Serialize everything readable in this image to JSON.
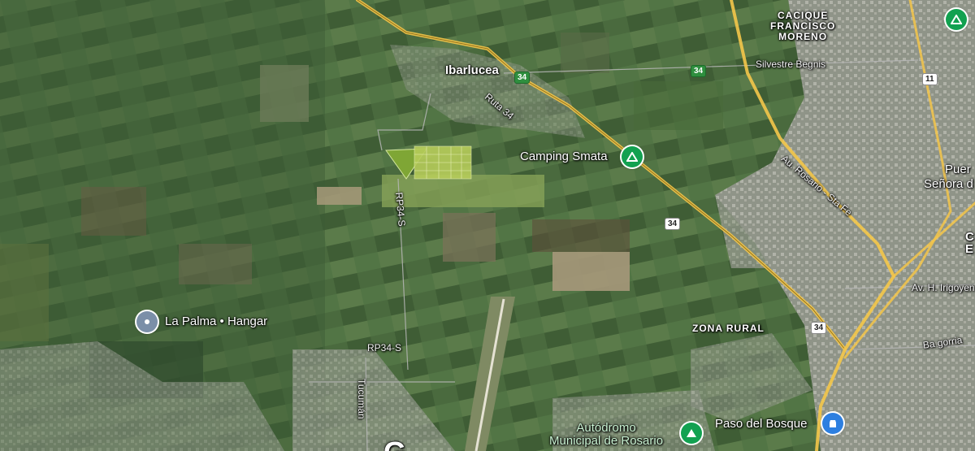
{
  "map": {
    "towns": {
      "ibarlucea": "Ibarlucea",
      "cacique": "CACIQUE\nFRANCISCO\nMORENO",
      "zona_rural": "ZONA RURAL",
      "puerto_partial": "Puer",
      "senora_partial": "Señora d",
      "c_partial": "C",
      "e_partial": "E",
      "bottom_partial": "G"
    },
    "streets": {
      "ruta34": "Ruta 34",
      "silvestre": "Silvestre Begnis",
      "au_rosario": "Au. Rosario - Sta Fe",
      "rp34s_top": "RP34-S",
      "rp34s_bottom": "RP34-S",
      "tucuman": "Tucumán",
      "av_irigoyen": "Av. H. Irigoyen",
      "baigorria": "Ba gorria"
    },
    "shields": {
      "s34_a": "34",
      "s34_b": "34",
      "s34_c": "34",
      "s34_d": "34",
      "s11": "11"
    },
    "pois": {
      "camping": "Camping Smata",
      "la_palma": "La Palma • Hangar",
      "autodromo": "Autódromo\nMunicipal de Rosario",
      "paso_bosque": "Paso del Bosque"
    },
    "colors": {
      "camping_pin": "#12a150",
      "la_palma_pin": "#7b8fa8",
      "autodromo_pin": "#12a150",
      "paso_bosque_pin": "#2d7fe0"
    },
    "icons": {
      "camping": "tent-icon",
      "la_palma": "location-pin-icon",
      "autodromo": "park-icon",
      "paso_bosque": "store-icon",
      "corner": "park-icon"
    }
  }
}
